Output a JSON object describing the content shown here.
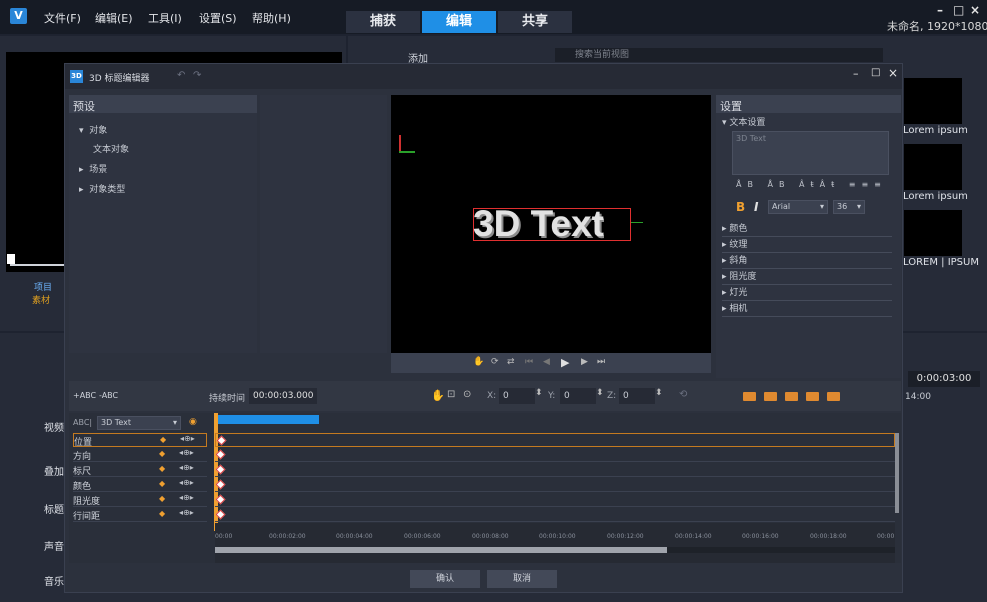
{
  "app": {
    "logo": "V",
    "menus": [
      "文件(F)",
      "编辑(E)",
      "工具(I)",
      "设置(S)",
      "帮助(H)"
    ],
    "tabs": [
      "捕获",
      "编辑",
      "共享"
    ],
    "active_tab": "编辑",
    "project_title": "未命名, 1920*1080"
  },
  "library": {
    "add_label": "添加",
    "search_placeholder": "搜索当前视图",
    "thumbs": [
      "Lorem ipsum",
      "Lorem ipsum",
      "LOREM | IPSUM"
    ]
  },
  "left_panel": {
    "project_label": "项目",
    "clip_label": "素材"
  },
  "tracks": [
    "视频",
    "叠加",
    "标题",
    "声音",
    "音乐"
  ],
  "right_time": {
    "timecode": "0:00:03:00",
    "ruler_time": "14:00"
  },
  "dialog": {
    "title": "3D 标题编辑器",
    "presets": {
      "header": "预设",
      "items": [
        {
          "label": "对象",
          "expanded": true,
          "children": [
            "文本对象"
          ]
        },
        {
          "label": "场景",
          "expanded": false
        },
        {
          "label": "对象类型",
          "expanded": false
        }
      ]
    },
    "preview_text": "3D Text",
    "settings": {
      "header": "设置",
      "text_settings": "文本设置",
      "text_value": "3D Text",
      "bold": "B",
      "italic": "I",
      "font": "Arial",
      "size": "36",
      "sections": [
        "颜色",
        "纹理",
        "斜角",
        "阻光度",
        "灯光",
        "相机"
      ]
    },
    "timeline": {
      "add_text": "+ABC",
      "remove_text": "-ABC",
      "duration_label": "持续时间",
      "duration": "00:00:03.000",
      "x_label": "X:",
      "x": "0",
      "y_label": "Y:",
      "y": "0",
      "z_label": "Z:",
      "z": "0",
      "object_prefix": "ABC|",
      "object": "3D Text",
      "rows": [
        "位置",
        "方向",
        "标尺",
        "颜色",
        "阻光度",
        "行间距"
      ],
      "ruler": [
        "00:00",
        "00:00:02:00",
        "00:00:04:00",
        "00:00:06:00",
        "00:00:08:00",
        "00:00:10:00",
        "00:00:12:00",
        "00:00:14:00",
        "00:00:16:00",
        "00:00:18:00",
        "00:00"
      ]
    },
    "ok": "确认",
    "cancel": "取消"
  }
}
